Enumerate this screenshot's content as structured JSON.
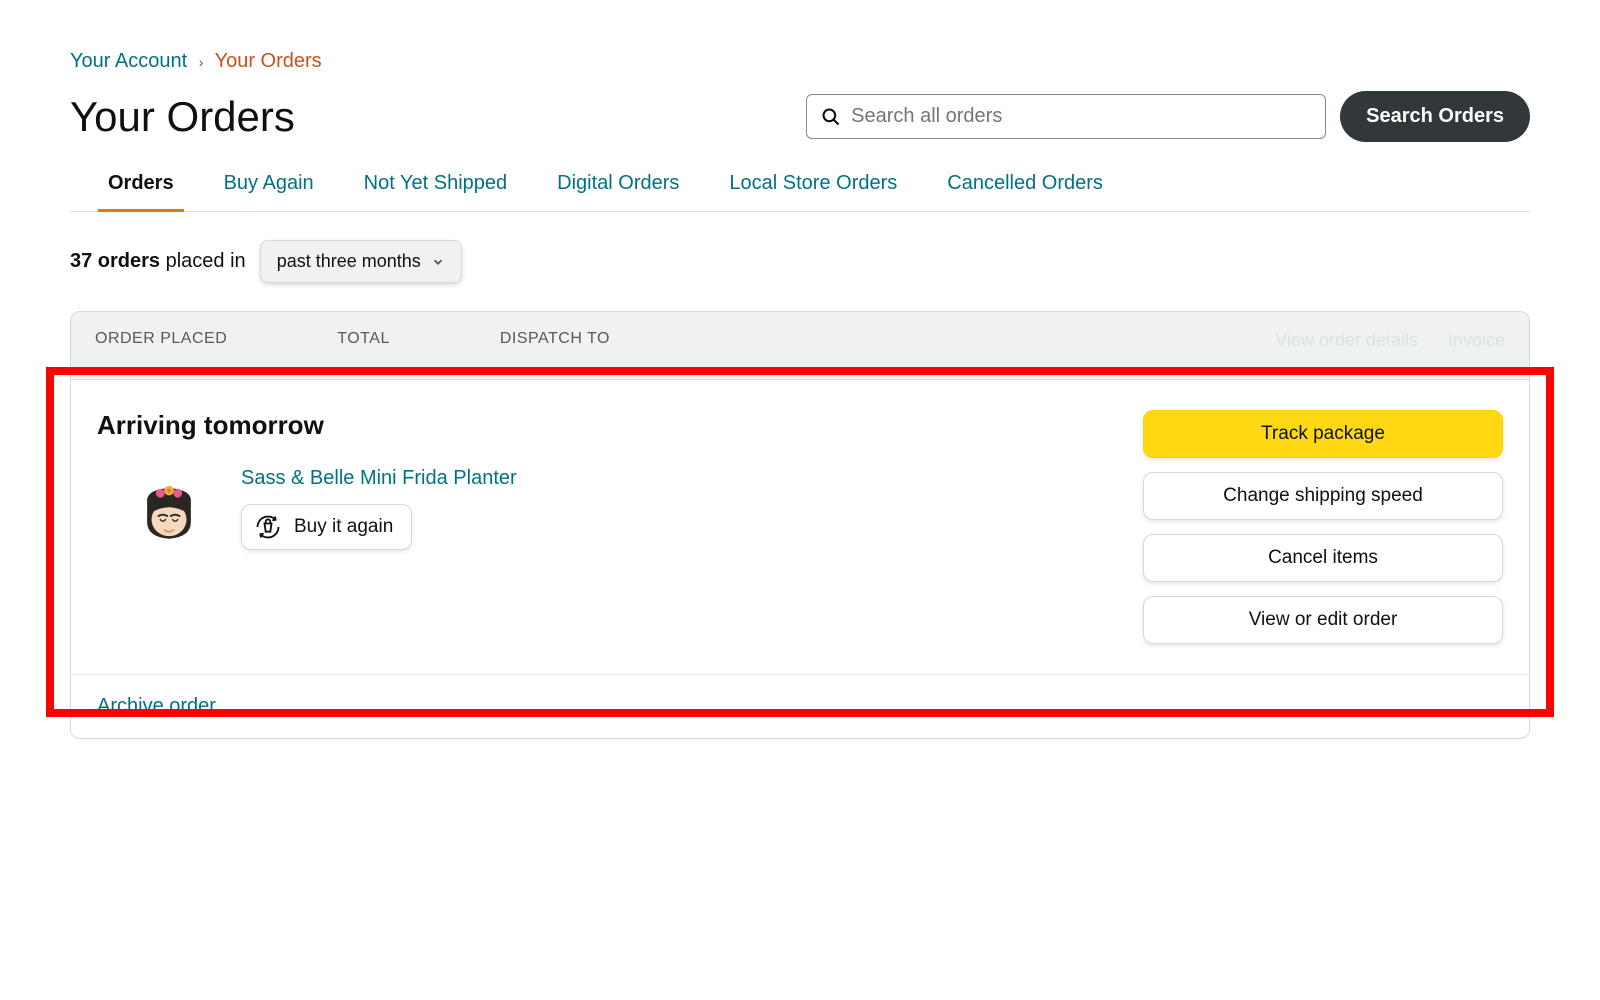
{
  "breadcrumb": {
    "account": "Your Account",
    "orders": "Your Orders"
  },
  "page": {
    "title": "Your Orders"
  },
  "search": {
    "placeholder": "Search all orders",
    "button": "Search Orders"
  },
  "tabs": {
    "orders": "Orders",
    "buy_again": "Buy Again",
    "not_shipped": "Not Yet Shipped",
    "digital": "Digital Orders",
    "local": "Local Store Orders",
    "cancelled": "Cancelled Orders"
  },
  "filter": {
    "count": "37 orders",
    "placed_in": " placed in ",
    "period": "past three months"
  },
  "order_card": {
    "head": {
      "order_placed_label": "ORDER PLACED",
      "total_label": "TOTAL",
      "dispatch_label": "DISPATCH TO",
      "view_details": "View order details",
      "invoice": "Invoice"
    },
    "status": "Arriving tomorrow",
    "item": {
      "title": "Sass & Belle Mini Frida Planter",
      "buy_again": "Buy it again"
    },
    "actions": {
      "track": "Track package",
      "change_speed": "Change shipping speed",
      "cancel": "Cancel items",
      "view_edit": "View or edit order"
    },
    "archive": "Archive order"
  }
}
